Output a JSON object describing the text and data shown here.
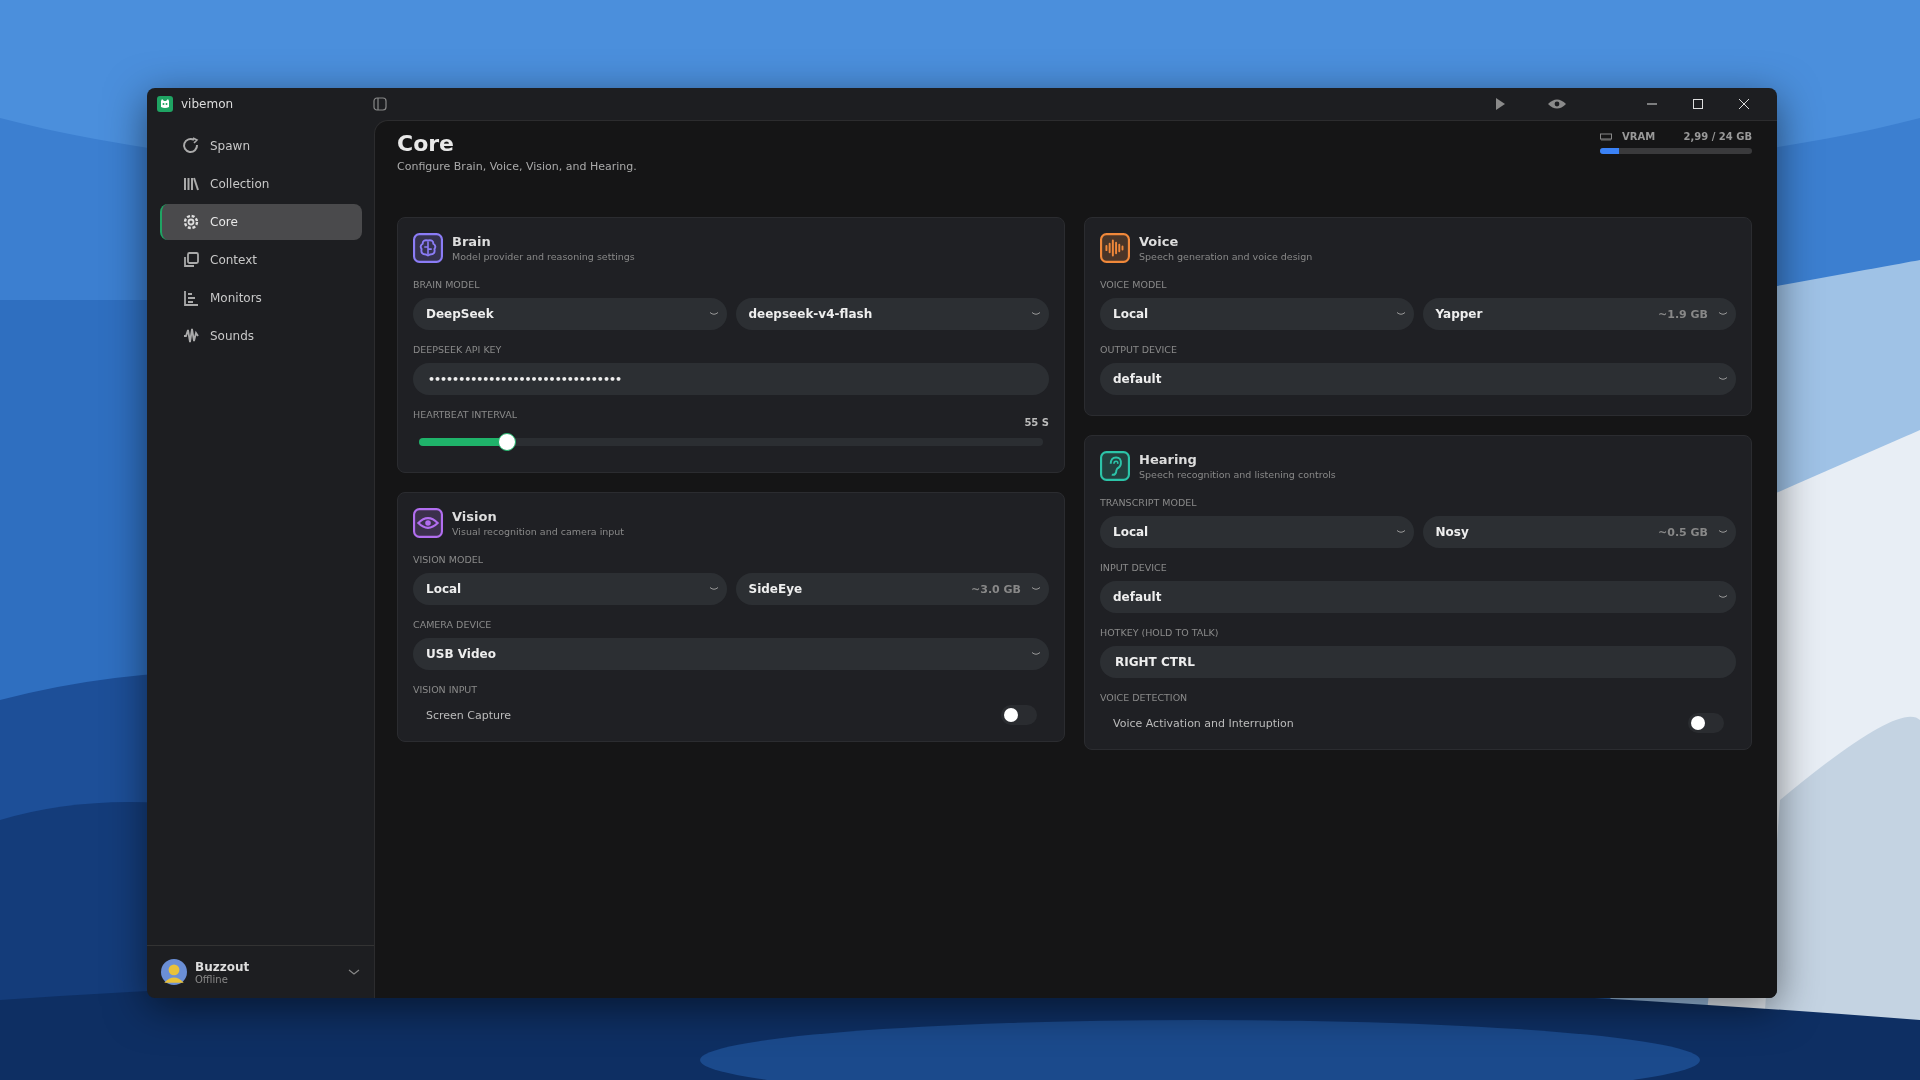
{
  "window": {
    "title": "vibemon"
  },
  "sidebar": {
    "items": [
      {
        "label": "Spawn",
        "selected": false
      },
      {
        "label": "Collection",
        "selected": false
      },
      {
        "label": "Core",
        "selected": true
      },
      {
        "label": "Context",
        "selected": false
      },
      {
        "label": "Monitors",
        "selected": false
      },
      {
        "label": "Sounds",
        "selected": false
      }
    ],
    "user": {
      "name": "Buzzout",
      "status": "Offline"
    }
  },
  "page": {
    "title": "Core",
    "subtitle": "Configure Brain, Voice, Vision, and Hearing."
  },
  "vram": {
    "label": "VRAM",
    "reading": "2,99 / 24 GB",
    "level": 0.125
  },
  "columns": [
    [
      {
        "kind": "brain",
        "title": "Brain",
        "subtitle": "Model provider and reasoning settings",
        "color": "#8b7cf6",
        "fields": [
          {
            "kind": "select_pair",
            "label": "BRAIN MODEL",
            "selects": [
              {
                "value": "DeepSeek"
              },
              {
                "value": "deepseek-v4-flash"
              }
            ]
          },
          {
            "kind": "password",
            "label": "DEEPSEEK API KEY",
            "value": "••••••••••••••••••••••••••••••••"
          },
          {
            "kind": "slider",
            "label": "HEARTBEAT INTERVAL",
            "reading": "55 S",
            "level": 0.14
          }
        ]
      },
      {
        "kind": "vision",
        "title": "Vision",
        "subtitle": "Visual recognition and camera input",
        "color": "#b26ef0",
        "fields": [
          {
            "kind": "select_pair",
            "label": "VISION MODEL",
            "selects": [
              {
                "value": "Local"
              },
              {
                "value": "SideEye",
                "size": "~3.0 GB"
              }
            ]
          },
          {
            "kind": "select",
            "label": "CAMERA DEVICE",
            "value": "USB Video"
          },
          {
            "kind": "toggle",
            "label": "VISION INPUT",
            "text": "Screen Capture",
            "on": false
          }
        ]
      }
    ],
    [
      {
        "kind": "voice",
        "title": "Voice",
        "subtitle": "Speech generation and voice design",
        "color": "#f0883a",
        "fields": [
          {
            "kind": "select_pair",
            "label": "VOICE MODEL",
            "selects": [
              {
                "value": "Local"
              },
              {
                "value": "Yapper",
                "size": "~1.9 GB"
              }
            ]
          },
          {
            "kind": "select",
            "label": "OUTPUT DEVICE",
            "value": "default"
          }
        ]
      },
      {
        "kind": "hearing",
        "title": "Hearing",
        "subtitle": "Speech recognition and listening controls",
        "color": "#2cc4a8",
        "fields": [
          {
            "kind": "select_pair",
            "label": "TRANSCRIPT MODEL",
            "selects": [
              {
                "value": "Local"
              },
              {
                "value": "Nosy",
                "size": "~0.5 GB"
              }
            ]
          },
          {
            "kind": "select",
            "label": "INPUT DEVICE",
            "value": "default"
          },
          {
            "kind": "text",
            "label": "HOTKEY (HOLD TO TALK)",
            "value": "RIGHT CTRL"
          },
          {
            "kind": "toggle",
            "label": "VOICE DETECTION",
            "text": "Voice Activation and Interruption",
            "on": false
          }
        ]
      }
    ]
  ]
}
